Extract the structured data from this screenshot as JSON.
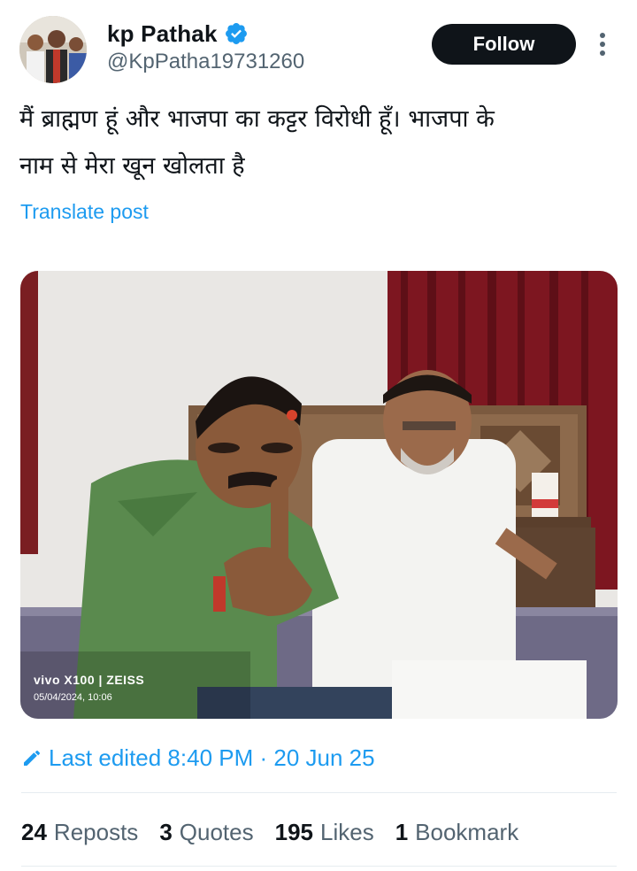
{
  "author": {
    "display_name": "kp Pathak",
    "handle": "@KpPatha19731260",
    "verified": true
  },
  "actions": {
    "follow_label": "Follow"
  },
  "post": {
    "text_line1": "मैं  ब्राह्मण हूं और भाजपा का कट्टर विरोधी हूँ। भाजपा के",
    "text_line2": "नाम से मेरा खून खोलता है",
    "translate_label": "Translate post"
  },
  "media": {
    "watermark_brand": "vivo X100 | ZEISS",
    "watermark_date": "05/04/2024, 10:06"
  },
  "edited": {
    "label": "Last edited 8:40 PM · 20 Jun 25"
  },
  "stats": [
    {
      "count": "24",
      "label": "Reposts"
    },
    {
      "count": "3",
      "label": "Quotes"
    },
    {
      "count": "195",
      "label": "Likes"
    },
    {
      "count": "1",
      "label": "Bookmark"
    }
  ],
  "colors": {
    "accent": "#1d9bf0",
    "text": "#0f1419",
    "muted": "#536471",
    "follow_bg": "#0f1419"
  },
  "icons": {
    "verified": "verified-badge-icon",
    "more": "more-options-icon",
    "edit": "edit-pencil-icon"
  }
}
